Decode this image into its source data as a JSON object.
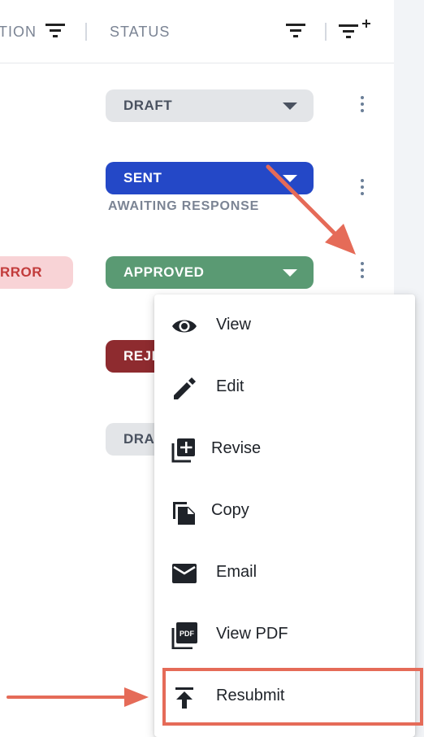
{
  "header": {
    "col_left_partial": "TION",
    "col_status": "STATUS"
  },
  "rows": [
    {
      "status": "DRAFT",
      "status_color": "#e3e5e8",
      "status_text_color": "#4a5260"
    },
    {
      "status": "SENT",
      "status_color": "#2448c7",
      "status_text_color": "#ffffff",
      "sub": "AWAITING RESPONSE"
    },
    {
      "status": "APPROVED",
      "status_color": "#5a9a73",
      "status_text_color": "#ffffff",
      "left_badge": "RROR",
      "left_badge_color": "#f8d3d6",
      "left_badge_text_color": "#c23b3b"
    },
    {
      "status": "REJE",
      "status_color": "#8e2b2f",
      "status_text_color": "#ffffff"
    },
    {
      "status": "DRA",
      "status_color": "#e3e5e8",
      "status_text_color": "#4a5260"
    }
  ],
  "menu": {
    "items": [
      {
        "label": "View",
        "icon": "eye-icon"
      },
      {
        "label": "Edit",
        "icon": "pencil-icon"
      },
      {
        "label": "Revise",
        "icon": "add-to-library-icon"
      },
      {
        "label": "Copy",
        "icon": "copy-icon"
      },
      {
        "label": "Email",
        "icon": "envelope-icon"
      },
      {
        "label": "View PDF",
        "icon": "pdf-icon"
      },
      {
        "label": "Resubmit",
        "icon": "publish-upload-icon"
      }
    ]
  },
  "annotations": {
    "color": "#e56b58"
  }
}
